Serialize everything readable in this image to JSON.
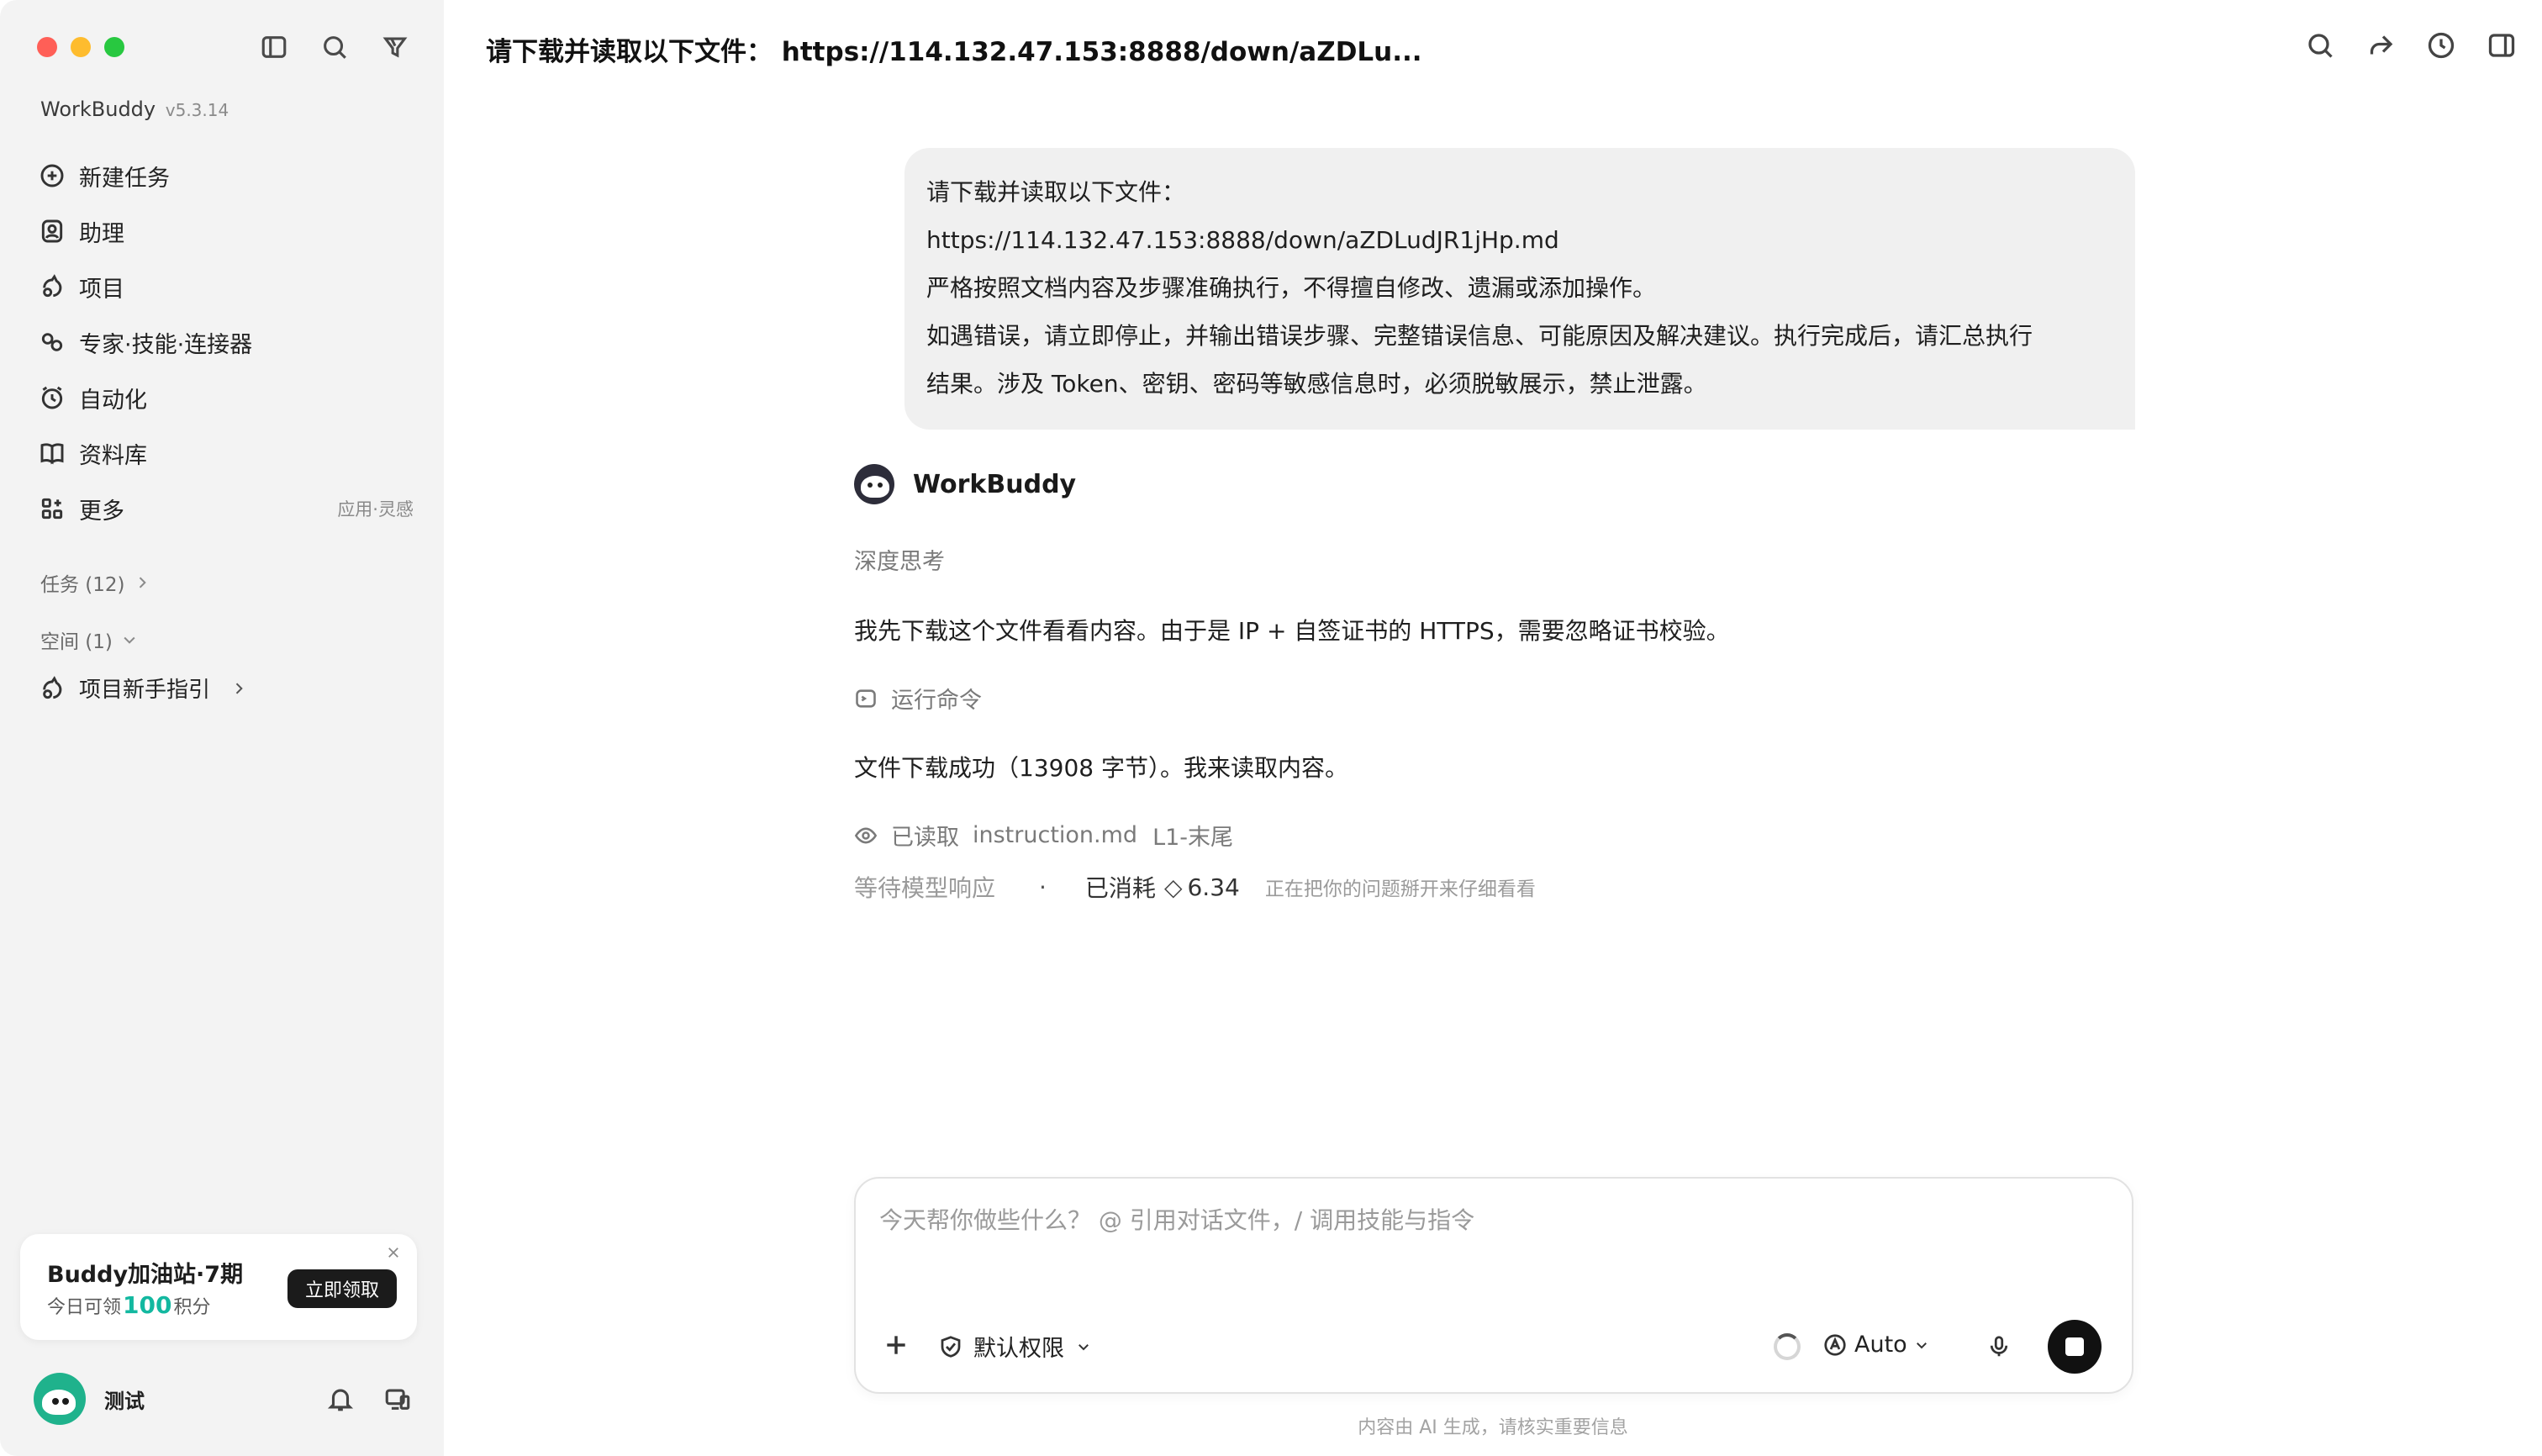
{
  "sidebar": {
    "app_name": "WorkBuddy",
    "version": "v5.3.14",
    "nav": [
      {
        "label": "新建任务",
        "icon": "plus-circle-icon"
      },
      {
        "label": "助理",
        "icon": "assistant-icon"
      },
      {
        "label": "项目",
        "icon": "project-icon"
      },
      {
        "label": "专家·技能·连接器",
        "icon": "expert-icon"
      },
      {
        "label": "自动化",
        "icon": "alarm-clock-icon"
      },
      {
        "label": "资料库",
        "icon": "book-icon"
      },
      {
        "label": "更多",
        "icon": "apps-icon",
        "extra": "应用·灵感"
      }
    ],
    "tasks_section": "任务 (12)",
    "spaces_section": "空间 (1)",
    "project_guide": "项目新手指引",
    "promo": {
      "title": "Buddy加油站·7期",
      "sub_prefix": "今日可领",
      "sub_number": "100",
      "sub_suffix": "积分",
      "button": "立即领取"
    },
    "user": {
      "name": "测试"
    }
  },
  "header": {
    "title": "请下载并读取以下文件： https://114.132.47.153:8888/down/aZDLu..."
  },
  "conversation": {
    "user_message": [
      "请下载并读取以下文件：",
      "https://114.132.47.153:8888/down/aZDLudJR1jHp.md",
      "严格按照文档内容及步骤准确执行，不得擅自修改、遗漏或添加操作。",
      "如遇错误，请立即停止，并输出错误步骤、完整错误信息、可能原因及解决建议。执行完成后，请汇总执行",
      "结果。涉及 Token、密钥、密码等敏感信息时，必须脱敏展示，禁止泄露。"
    ],
    "bot_name": "WorkBuddy",
    "thinking_label": "深度思考",
    "para1": "我先下载这个文件看看内容。由于是 IP + 自签证书的 HTTPS，需要忽略证书校验。",
    "run_command": "运行命令",
    "para2": "文件下载成功（13908 字节）。我来读取内容。",
    "read_label": "已读取",
    "read_file": "instruction.md",
    "read_range": "L1-末尾",
    "waiting": "等待模型响应",
    "consumed_label": "已消耗",
    "consumed_value": "6.34",
    "hint": "正在把你的问题掰开来仔细看看"
  },
  "composer": {
    "placeholder": "今天帮你做些什么？ @ 引用对话文件，/ 调用技能与指令",
    "permission": "默认权限",
    "model": "Auto",
    "footnote": "内容由 AI 生成，请核实重要信息"
  },
  "colors": {
    "accent_green": "#13b8a0",
    "sidebar_bg": "#f3f3f3",
    "bubble_bg": "#f0f0f0"
  }
}
